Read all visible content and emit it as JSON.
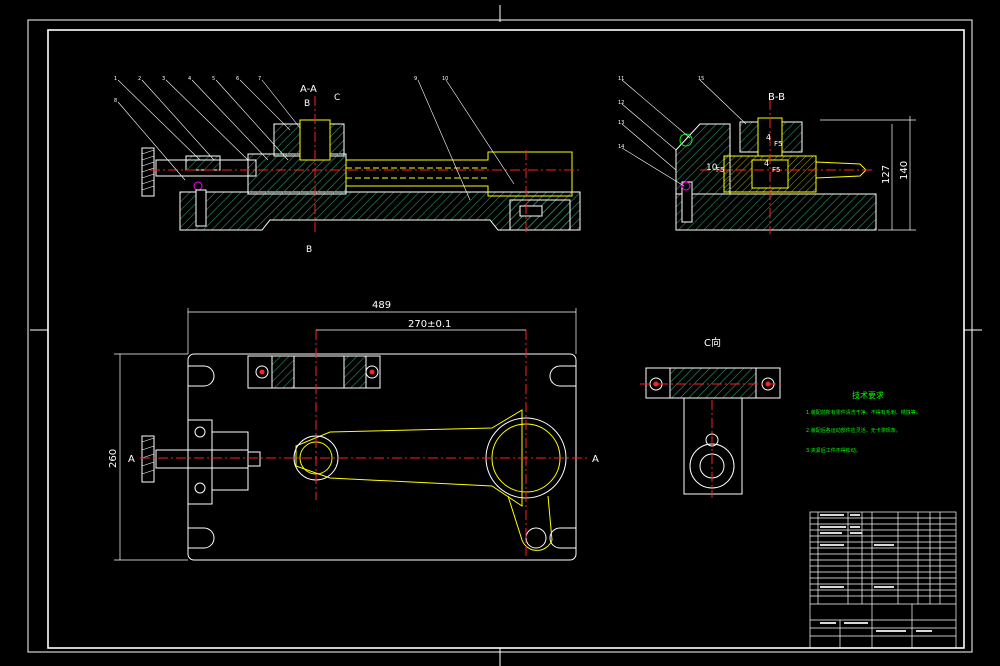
{
  "colors": {
    "background": "#000000",
    "outline": "#ffffff",
    "hatch": "#3a9e7a",
    "dimension": "#ffffff",
    "centerline": "#ff2020",
    "yellow": "#ffff00",
    "green": "#00ff00",
    "magenta": "#ff00ff"
  },
  "views": {
    "section_aa": {
      "title": "A-A",
      "cut_b_top": "B",
      "cut_b_bottom": "B",
      "cut_c": "C"
    },
    "section_bb": {
      "title": "B-B",
      "dim_127": "127",
      "dim_140": "140",
      "note_1": "10",
      "note_2": "F5",
      "note_3": "F5",
      "note_4": "4",
      "note_5": "4",
      "note_6": "F5"
    },
    "plan": {
      "dim_width": "489",
      "dim_center": "270±0.1",
      "dim_height": "260",
      "cut_a_left": "A",
      "cut_a_right": "A"
    },
    "view_c": {
      "title": "C向"
    }
  },
  "tech_requirements": {
    "heading": "技术要求",
    "lines": [
      "1.装配前所有零件清洗干净，不得有毛刺、锈蚀等。",
      "2.装配后各运动部件应灵活，无卡滞现象。",
      "3.夹紧后工件不得松动。"
    ]
  }
}
